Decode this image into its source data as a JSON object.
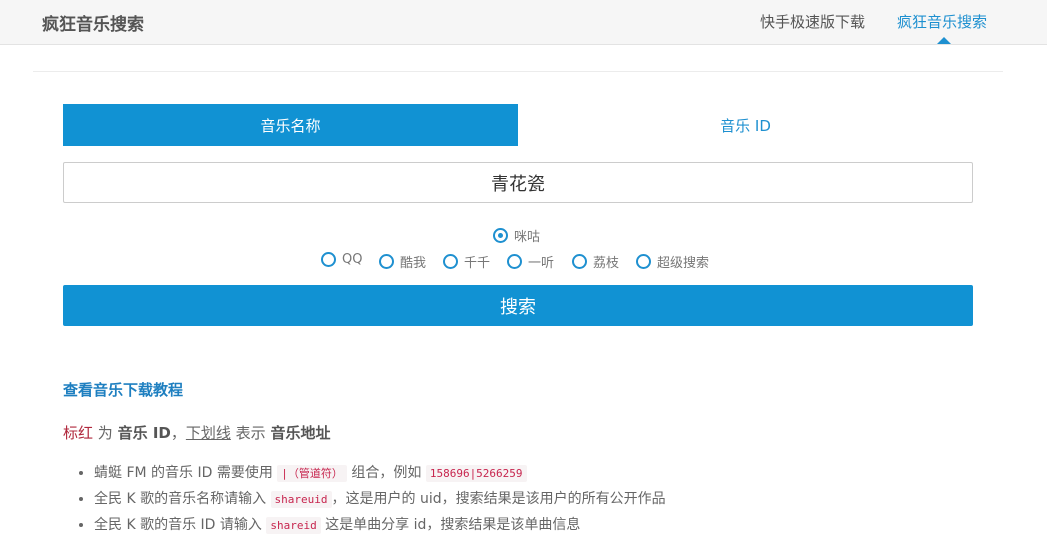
{
  "header": {
    "brand": "疯狂音乐搜索",
    "nav": [
      {
        "label": "快手极速版下载"
      },
      {
        "label": "疯狂音乐搜索"
      }
    ]
  },
  "tabs": [
    {
      "label": "音乐名称",
      "active": true
    },
    {
      "label": "音乐 ID",
      "active": false
    }
  ],
  "search": {
    "value": "青花瓷"
  },
  "sources": {
    "selected": "咪咕",
    "options": [
      "咪咕",
      "QQ",
      "酷我",
      "千千",
      "一听",
      "荔枝",
      "超级搜索"
    ]
  },
  "search_button": "搜索",
  "tutorial_link": "查看音乐下载教程",
  "legend": {
    "red_text": "标红",
    "word_is": "为",
    "bold_id": "音乐 ID",
    "comma": "，",
    "underline_text": "下划线",
    "word_means": "表示",
    "bold_addr": "音乐地址"
  },
  "tips": [
    {
      "before": "蜻蜓 FM 的音乐 ID 需要使用",
      "code": "|（管道符）",
      "after": "组合，例如",
      "code2": "158696|5266259"
    },
    {
      "before": "全民 K 歌的音乐名称请输入",
      "code": "shareuid",
      "after": "，这是用户的 uid，搜索结果是该用户的所有公开作品"
    },
    {
      "before": "全民 K 歌的音乐 ID 请输入",
      "code": "shareid",
      "after": "这是单曲分享 id，搜索结果是该单曲信息"
    }
  ],
  "colors": {
    "accent": "#1192d3",
    "link": "#1e90d0",
    "highlight_red": "#b0283d"
  }
}
